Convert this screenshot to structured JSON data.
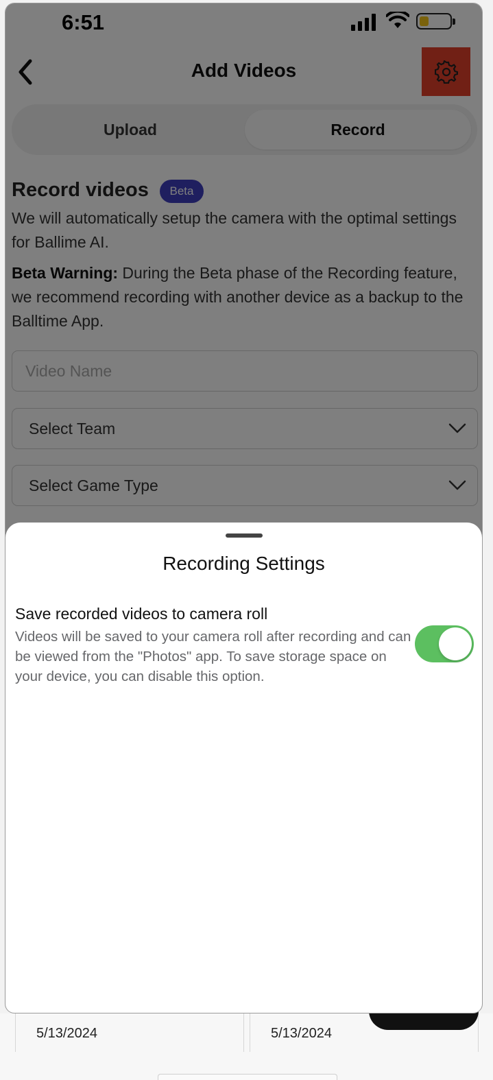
{
  "status_bar": {
    "time": "6:51"
  },
  "header": {
    "title": "Add Videos"
  },
  "tabs": [
    {
      "label": "Upload"
    },
    {
      "label": "Record"
    }
  ],
  "record_section": {
    "title": "Record videos",
    "badge": "Beta",
    "description": "We will automatically setup the camera with the optimal settings for Ballime AI.",
    "warning_label": "Beta Warning:",
    "warning_text": " During the Beta phase of the Recording feature, we recommend recording with another device as a backup to the Balltime App."
  },
  "form": {
    "video_name_placeholder": "Video Name",
    "team_select": "Select Team",
    "game_type_select": "Select Game Type"
  },
  "sheet": {
    "title": "Recording Settings",
    "setting_title": "Save recorded videos to camera roll",
    "setting_description": "Videos will be saved to your camera roll after recording and can be viewed from the \"Photos\" app. To save storage space on your device, you can disable this option.",
    "toggle_on": true
  },
  "background_list": {
    "dates": [
      "5/13/2024",
      "5/13/2024"
    ]
  },
  "colors": {
    "accent_badge": "#3e3fbf",
    "toggle_on": "#5cbf60",
    "highlight": "#e2412b"
  }
}
